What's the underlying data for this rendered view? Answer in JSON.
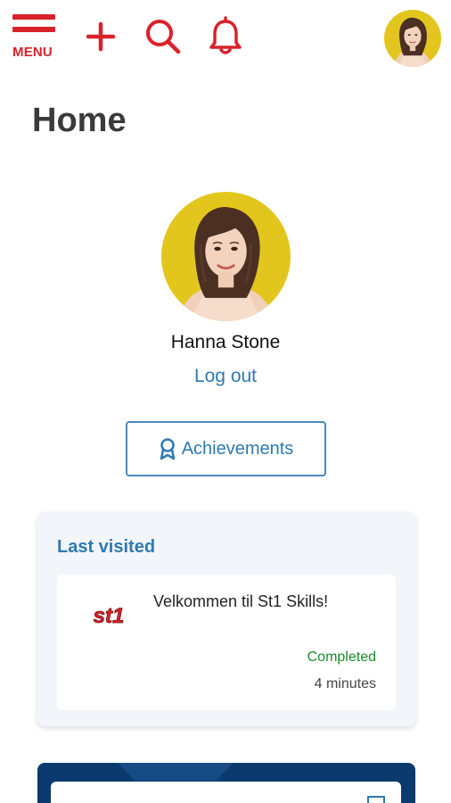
{
  "header": {
    "menu_label": "MENU",
    "icons": [
      "plus-icon",
      "search-icon",
      "bell-icon"
    ]
  },
  "page": {
    "title": "Home"
  },
  "profile": {
    "name": "Hanna Stone",
    "logout_label": "Log out",
    "achievements_label": "Achievements"
  },
  "last_visited": {
    "heading": "Last visited",
    "item": {
      "logo_text": "st1",
      "title": "Velkommen til St1 Skills!",
      "status": "Completed",
      "duration": "4 minutes"
    }
  },
  "colors": {
    "brand_red": "#d9222a",
    "link_blue": "#2f7ab0",
    "status_green": "#1a8a2a",
    "banner_navy": "#0b3a6e"
  }
}
